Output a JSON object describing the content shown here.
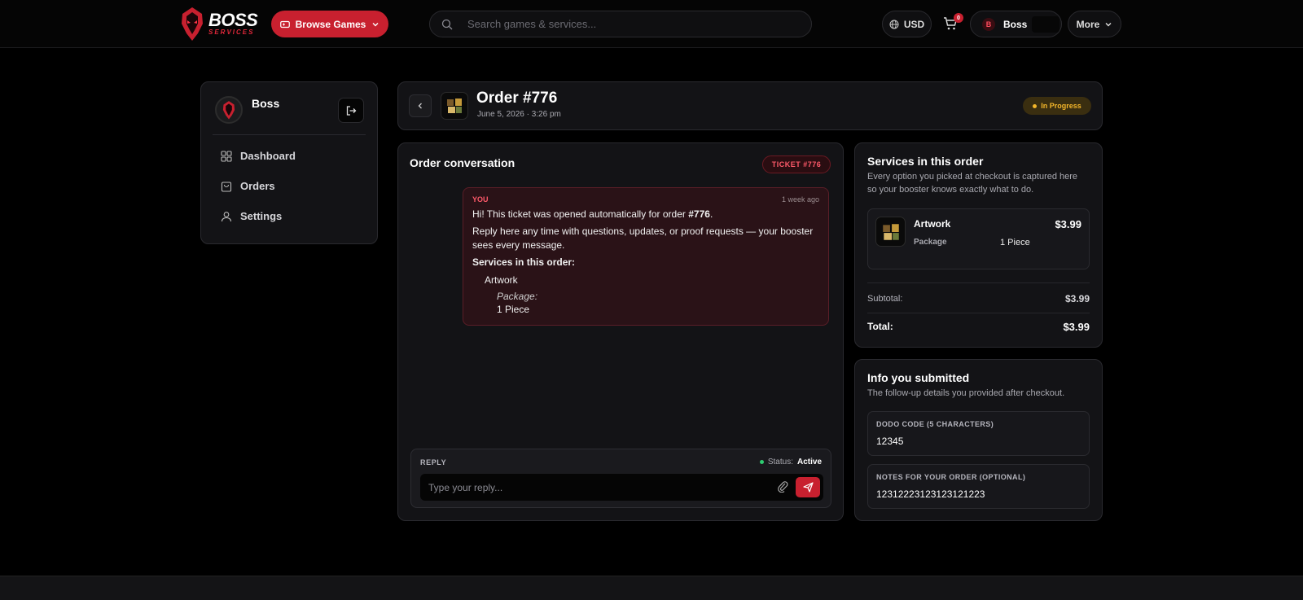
{
  "topbar": {
    "logo_word": "BOSS",
    "logo_sub": "SERVICES",
    "browse_label": "Browse Games",
    "search_placeholder": "Search games & services...",
    "currency": "USD",
    "cart_count": "0",
    "user_initial": "B",
    "user_name": "Boss",
    "more_label": "More"
  },
  "sidebar": {
    "name": "Boss",
    "items": [
      {
        "label": "Dashboard",
        "icon": "grid-icon"
      },
      {
        "label": "Orders",
        "icon": "bag-icon"
      },
      {
        "label": "Settings",
        "icon": "user-icon"
      }
    ]
  },
  "order": {
    "title": "Order #776",
    "date": "June 5, 2026 · 3:26 pm",
    "status": "In Progress"
  },
  "conversation": {
    "title": "Order conversation",
    "ticket": "TICKET #776",
    "message": {
      "author": "YOU",
      "time": "1 week ago",
      "line1_prefix": "Hi! This ticket was opened automatically for order ",
      "line1_bold": "#776",
      "line1_suffix": ".",
      "line2": "Reply here any time with questions, updates, or proof requests — your booster",
      "line3": "sees every message.",
      "services_heading": "Services in this order:",
      "service_name": "Artwork",
      "option_label": "Package:",
      "option_value": "1 Piece"
    },
    "reply": {
      "label": "REPLY",
      "status_label": "Status:",
      "status_value": "Active",
      "placeholder": "Type your reply..."
    }
  },
  "services_panel": {
    "title": "Services in this order",
    "subtitle_line1": "Every option you picked at checkout is captured here",
    "subtitle_line2": "so your booster knows exactly what to do.",
    "item": {
      "name": "Artwork",
      "price": "$3.99",
      "option_label": "Package",
      "option_value": "1 Piece"
    },
    "subtotal_label": "Subtotal:",
    "subtotal_value": "$3.99",
    "total_label": "Total:",
    "total_value": "$3.99"
  },
  "info_panel": {
    "title": "Info you submitted",
    "subtitle": "The follow-up details you provided after checkout.",
    "fields": [
      {
        "label": "DODO CODE (5 CHARACTERS)",
        "value": "12345"
      },
      {
        "label": "NOTES FOR YOUR ORDER (OPTIONAL)",
        "value": "12312223123123121223"
      }
    ]
  },
  "colors": {
    "accent": "#c8202f",
    "background": "#000000",
    "panel": "#131316",
    "status_progress": "#f3b52a",
    "status_active": "#2ecc71"
  }
}
